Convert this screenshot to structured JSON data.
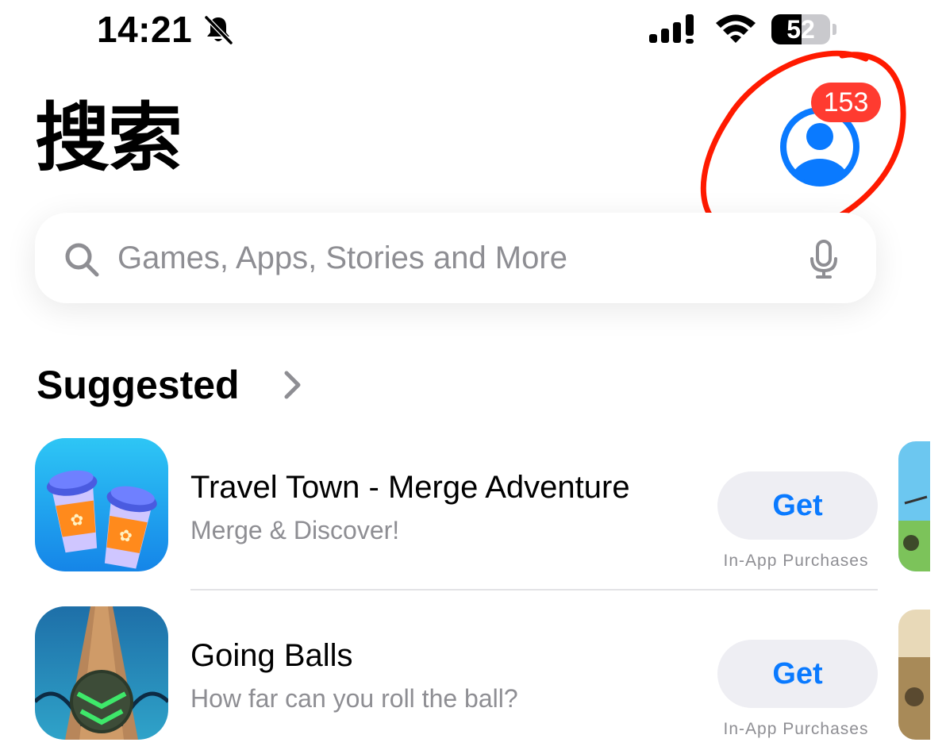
{
  "status_bar": {
    "time": "14:21",
    "battery": "52"
  },
  "header": {
    "title": "搜索",
    "notification_count": "153"
  },
  "search": {
    "placeholder": "Games, Apps, Stories and More"
  },
  "section": {
    "title": "Suggested"
  },
  "apps": [
    {
      "name": "Travel Town - Merge Adventure",
      "subtitle": "Merge & Discover!",
      "button": "Get",
      "note": "In-App Purchases"
    },
    {
      "name": "Going Balls",
      "subtitle": "How far can you roll the ball?",
      "button": "Get",
      "note": "In-App Purchases"
    }
  ],
  "colors": {
    "accent": "#0a7aff",
    "badge": "#ff3b30",
    "annotation": "#ff1a00"
  },
  "icons": [
    "bell-slash-icon",
    "cellular-signal-icon",
    "wifi-icon",
    "battery-icon",
    "account-icon",
    "search-icon",
    "microphone-icon",
    "chevron-right-icon"
  ]
}
